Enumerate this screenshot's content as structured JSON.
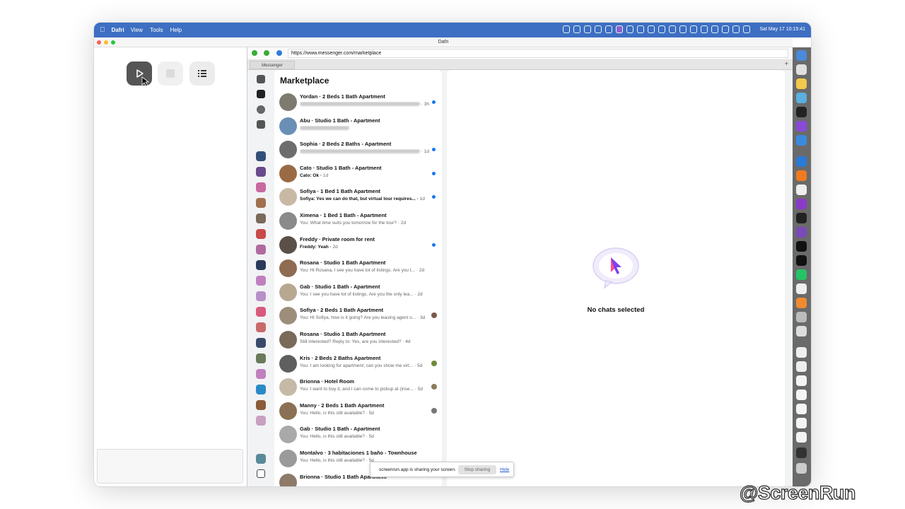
{
  "menubar": {
    "app": "Dafri",
    "menus": [
      "View",
      "Tools",
      "Help"
    ],
    "datetime": "Sat May 17  10:15:41"
  },
  "window": {
    "title": "Dafri"
  },
  "browser": {
    "url": "https://www.messenger.com/marketplace",
    "tab": "Messenger",
    "new_tab": "+"
  },
  "marketplace": {
    "title": "Marketplace",
    "chats": [
      {
        "name": "Yordan · 2 Beds 1 Bath Apartment",
        "preview": "",
        "time": "3h",
        "unread": true,
        "blurred": true,
        "avatar": "#7d7a6f"
      },
      {
        "name": "Abu · Studio 1 Bath - Apartment",
        "preview": "",
        "time": "",
        "unread": false,
        "blurred": true,
        "avatar": "#6a8fb4"
      },
      {
        "name": "Sophia · 2 Beds 2 Baths - Apartment",
        "preview": "",
        "time": "1d",
        "unread": true,
        "blurred": true,
        "avatar": "#6d6d6d"
      },
      {
        "name": "Cato · Studio 1 Bath - Apartment",
        "preview": "Cato: Ok",
        "time": "1d",
        "unread": true,
        "blurred": false,
        "avatar": "#9a6a44"
      },
      {
        "name": "Sofiya · 1 Bed 1 Bath Apartment",
        "preview": "Sofiya: Yes we can do that, but virtual tour requires...",
        "time": "1d",
        "unread": true,
        "blurred": false,
        "avatar": "#c9b8a4"
      },
      {
        "name": "Ximena · 1 Bed 1 Bath - Apartment",
        "preview": "You: What time suits you tomorrow for the tour?",
        "time": "2d",
        "unread": false,
        "blurred": false,
        "avatar": "#8a8a8a"
      },
      {
        "name": "Freddy · Private room for rent",
        "preview": "Freddy: Yeah",
        "time": "2d",
        "unread": true,
        "blurred": false,
        "avatar": "#5a5048"
      },
      {
        "name": "Rosana · Studio 1 Bath Apartment",
        "preview": "You: Hi Rosana, I see you have lot of listings. Are you t...",
        "time": "2d",
        "unread": false,
        "blurred": false,
        "avatar": "#8f6b52"
      },
      {
        "name": "Gab · Studio 1 Bath - Apartment",
        "preview": "You: I see you have lot of listings. Are you the only lea...",
        "time": "2d",
        "unread": false,
        "blurred": false,
        "avatar": "#b8a891"
      },
      {
        "name": "Sofiya · 2 Beds 1 Bath Apartment",
        "preview": "You: Hi Sofiya, how is it going? Are you leasing agent o...",
        "time": "3d",
        "unread": false,
        "blurred": false,
        "avatar": "#9d8e7c",
        "mini": "#7a5a4a"
      },
      {
        "name": "Rosana · Studio 1 Bath Apartment",
        "preview": "Still interested? Reply to: Yes, are you interested?",
        "time": "4d",
        "unread": false,
        "blurred": false,
        "avatar": "#7a6a5a"
      },
      {
        "name": "Kris · 2 Beds 2 Baths Apartment",
        "preview": "You: I am looking for apartment; can you show me virt...",
        "time": "5d",
        "unread": false,
        "blurred": false,
        "avatar": "#5f5f5f",
        "mini": "#6f8a3a"
      },
      {
        "name": "Brionna · Hotel Room",
        "preview": "You: I want to buy it, and I can come to pickup at (inse...",
        "time": "5d",
        "unread": false,
        "blurred": false,
        "avatar": "#c7b9a8",
        "mini": "#8a7a5a"
      },
      {
        "name": "Manny · 2 Beds 1 Bath Apartment",
        "preview": "You: Hello, is this still available?",
        "time": "5d",
        "unread": false,
        "blurred": false,
        "avatar": "#8a7055",
        "mini": "#777777"
      },
      {
        "name": "Gab · Studio 1 Bath - Apartment",
        "preview": "You: Hello, is this still available?",
        "time": "5d",
        "unread": false,
        "blurred": false,
        "avatar": "#a9a9a9"
      },
      {
        "name": "Montalvo · 3 habitaciones 1 baño - Townhouse",
        "preview": "You: Hello, is this still available?",
        "time": "5d",
        "unread": false,
        "blurred": false,
        "avatar": "#9a9a9a"
      },
      {
        "name": "Brionna · Studio 1 Bath Apartment",
        "preview": "",
        "time": "",
        "unread": false,
        "blurred": false,
        "avatar": "#8d7a68"
      }
    ]
  },
  "main": {
    "empty_text": "No chats selected"
  },
  "share_bar": {
    "message": "screenrun.app is sharing your screen.",
    "stop": "Stop sharing",
    "hide": "Hide"
  },
  "watermark": "@ScreenRun",
  "colors": {
    "menubar": "#3d6fc2",
    "accent": "#1877f2",
    "dock": "#6a6a6a"
  },
  "icons": {
    "rail": [
      "chats-icon",
      "marketplace-icon",
      "message-requests-icon",
      "archive-icon"
    ],
    "player": [
      "play-icon",
      "stop-icon",
      "list-icon"
    ]
  }
}
